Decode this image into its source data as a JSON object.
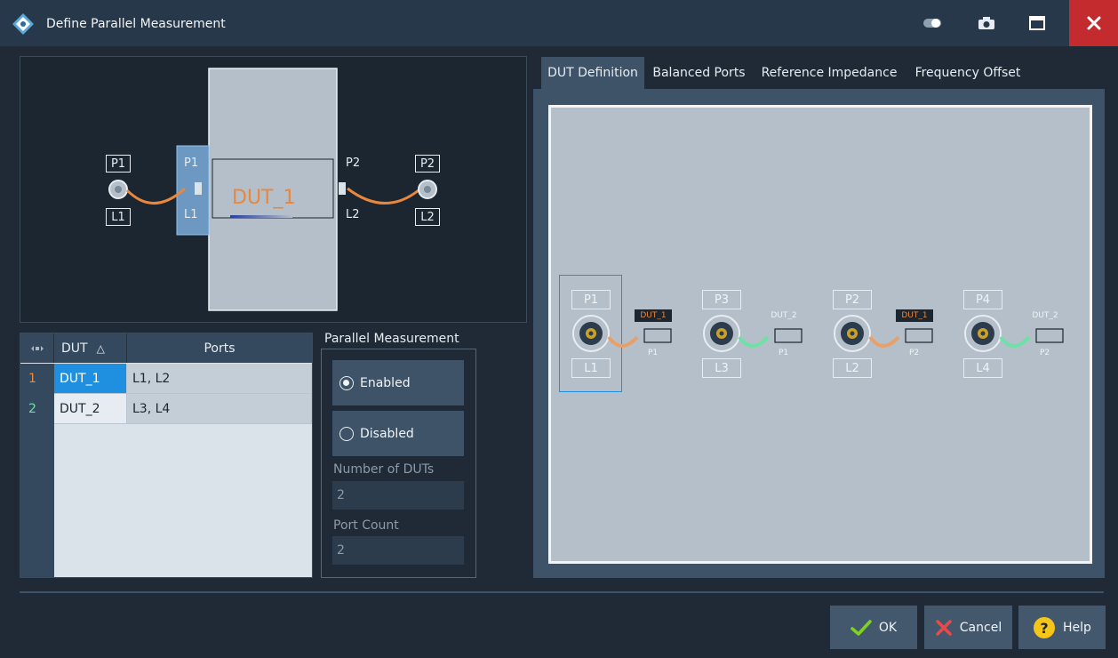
{
  "window": {
    "title": "Define Parallel Measurement",
    "icons": [
      "toggle-icon",
      "camera-icon",
      "maximize-icon",
      "close-icon"
    ]
  },
  "diagram": {
    "left_port_top": "P1",
    "left_port_bottom": "L1",
    "device_port_left_top": "P1",
    "device_port_left_bottom": "L1",
    "device_name": "DUT_1",
    "device_port_right_top": "P2",
    "device_port_right_bottom": "L2",
    "right_port_top": "P2",
    "right_port_bottom": "L2"
  },
  "table": {
    "columns": [
      "DUT",
      "Ports"
    ],
    "sort_indicator": "△",
    "rows": [
      {
        "num": "1",
        "dut": "DUT_1",
        "ports": "L1, L2"
      },
      {
        "num": "2",
        "dut": "DUT_2",
        "ports": "L3, L4"
      }
    ]
  },
  "parallel": {
    "title": "Parallel Measurement",
    "enabled_label": "Enabled",
    "disabled_label": "Disabled",
    "selected": "Enabled",
    "num_duts_label": "Number of DUTs",
    "num_duts_value": "2",
    "port_count_label": "Port Count",
    "port_count_value": "2"
  },
  "tabs": [
    "DUT Definition",
    "Balanced Ports",
    "Reference Impedance",
    "Frequency Offset"
  ],
  "active_tab": "DUT Definition",
  "dut_definition": {
    "ports": [
      {
        "top": "P1",
        "bottom": "L1",
        "dut": "DUT_1",
        "pin": "P1",
        "cable": "#e8a06a",
        "selected": true
      },
      {
        "top": "P3",
        "bottom": "L3",
        "dut": "DUT_2",
        "pin": "P1",
        "cable": "#6fe0a6",
        "selected": false
      },
      {
        "top": "P2",
        "bottom": "L2",
        "dut": "DUT_1",
        "pin": "P2",
        "cable": "#e8a06a",
        "selected": false
      },
      {
        "top": "P4",
        "bottom": "L4",
        "dut": "DUT_2",
        "pin": "P2",
        "cable": "#6fe0a6",
        "selected": false
      }
    ]
  },
  "buttons": {
    "ok": "OK",
    "cancel": "Cancel",
    "help": "Help"
  },
  "colors": {
    "accent_orange": "#e8873e",
    "accent_green": "#6fe0a6",
    "selection_blue": "#1f8fe0",
    "close_red": "#c42b2f"
  }
}
